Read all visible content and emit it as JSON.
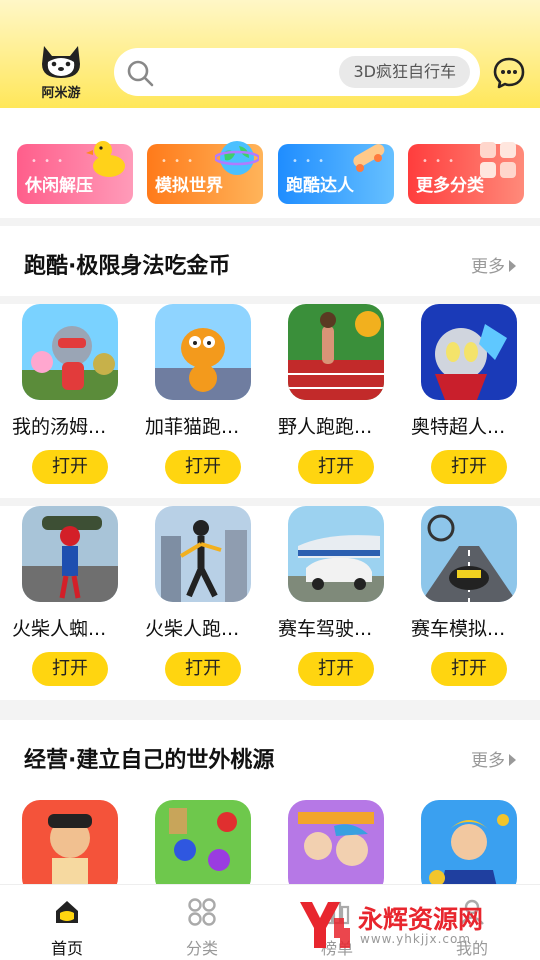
{
  "header": {
    "logo_text": "阿米游",
    "search_chip": "3D疯狂自行车"
  },
  "categories": [
    {
      "label": "休闲解压"
    },
    {
      "label": "模拟世界"
    },
    {
      "label": "跑酷达人"
    },
    {
      "label": "更多分类"
    }
  ],
  "section1": {
    "title": "跑酷·极限身法吃金币",
    "more": "更多",
    "row1": [
      {
        "name": "我的汤姆...",
        "button": "打开"
      },
      {
        "name": "加菲猫跑...",
        "button": "打开"
      },
      {
        "name": "野人跑跑...",
        "button": "打开"
      },
      {
        "name": "奥特超人...",
        "button": "打开"
      }
    ],
    "row2": [
      {
        "name": "火柴人蜘...",
        "button": "打开"
      },
      {
        "name": "火柴人跑...",
        "button": "打开"
      },
      {
        "name": "赛车驾驶...",
        "button": "打开"
      },
      {
        "name": "赛车模拟...",
        "button": "打开"
      }
    ]
  },
  "section2": {
    "title": "经营·建立自己的世外桃源",
    "more": "更多"
  },
  "bottom_nav": [
    {
      "label": "首页",
      "active": true
    },
    {
      "label": "分类",
      "active": false
    },
    {
      "label": "榜单",
      "active": false
    },
    {
      "label": "我的",
      "active": false
    }
  ],
  "watermark": {
    "text": "永辉资源网",
    "url": "www.yhkjjx.com"
  },
  "colors": {
    "brand_yellow": "#ffd510",
    "header_yellow": "#ffe75a",
    "watermark_red": "#e8262e"
  }
}
